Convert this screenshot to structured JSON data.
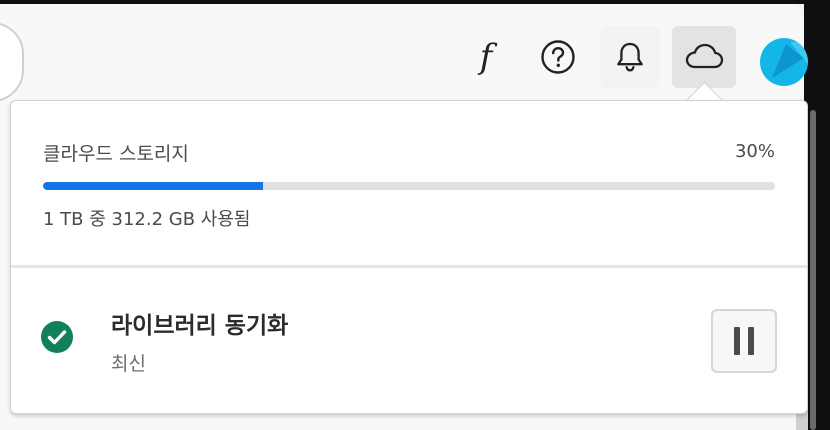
{
  "header": {
    "icons": [
      "font-icon",
      "help-icon",
      "bell-icon",
      "cloud-icon"
    ],
    "font_glyph": "f",
    "avatar_color": "#14b6e8"
  },
  "storage": {
    "title": "클라우드 스토리지",
    "percent_label": "30%",
    "used_fraction": 0.3,
    "usage_text": "1 TB 중 312.2 GB 사용됨",
    "bar_color": "#1473e6"
  },
  "sync": {
    "title": "라이브러리 동기화",
    "status": "최신",
    "status_color": "#12805c",
    "pause_icon": "pause-icon"
  }
}
